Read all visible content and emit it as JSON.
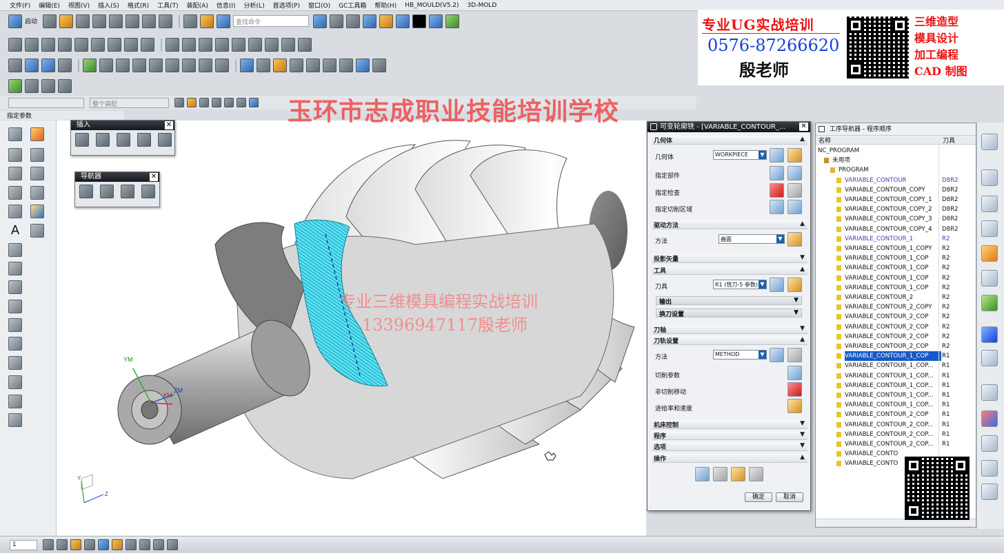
{
  "menu": [
    "文件(F)",
    "编辑(E)",
    "视图(V)",
    "插入(S)",
    "格式(R)",
    "工具(T)",
    "装配(A)",
    "信息(I)",
    "分析(L)",
    "首选项(P)",
    "窗口(O)",
    "GC工具箱",
    "帮助(H)",
    "HB_MOULD(V5.2)",
    "3D-MOLD"
  ],
  "toolbar": {
    "start_label": "启动",
    "search_placeholder": "查找命令"
  },
  "selection_bar": {
    "filter_value": "",
    "scope_value": "整个装配"
  },
  "panel_label": "指定参数",
  "insert_window": {
    "title": "插入"
  },
  "navigator_window": {
    "title": "导航器"
  },
  "ad": {
    "line1": "专业UG实战培训",
    "phone": "0576-87266620",
    "teacher": "殷老师",
    "tags": [
      "三维造型",
      "模具设计",
      "加工编程",
      "CAD 制图"
    ]
  },
  "school_name": "玉环市志成职业技能培训学校",
  "watermark": {
    "line1": "专业三维模具编程实战培训",
    "line2": "13396947117殷老师"
  },
  "axes": {
    "ym": "YM",
    "zm": "ZM",
    "xm": "XM",
    "y": "Y",
    "z": "Z"
  },
  "dialog": {
    "title": "可变轮廓铣 - [VARIABLE_CONTOUR_...",
    "sections": {
      "geometry": "几何体",
      "drive": "驱动方法",
      "projection": "投影矢量",
      "tool": "工具",
      "output": "输出",
      "tool_change": "换刀设置",
      "axis": "刀轴",
      "path_settings": "刀轨设置",
      "machine": "机床控制",
      "program": "程序",
      "options": "选项",
      "actions": "操作"
    },
    "labels": {
      "geometry": "几何体",
      "part": "指定部件",
      "check": "指定检查",
      "cut_area": "指定切削区域",
      "method_drive": "方法",
      "tool": "刀具",
      "method": "方法",
      "cut_params": "切削参数",
      "non_cut": "非切削移动",
      "feeds": "进给率和速度"
    },
    "values": {
      "geometry": "WORKPIECE",
      "drive_method": "曲面",
      "tool": "R1 (铣刀-5 参数)",
      "method": "METHOD"
    },
    "ok": "确定",
    "cancel": "取消"
  },
  "op_navigator": {
    "title": "工序导航器 - 程序顺序",
    "col_name": "名称",
    "col_tool": "刀具",
    "rows": [
      {
        "name": "NC_PROGRAM",
        "tool": "",
        "level": 0
      },
      {
        "name": "未用项",
        "tool": "",
        "level": 1
      },
      {
        "name": "PROGRAM",
        "tool": "",
        "level": 2
      },
      {
        "name": "VARIABLE_CONTOUR",
        "tool": "D8R2",
        "level": 3,
        "state": "purple"
      },
      {
        "name": "VARIABLE_CONTOUR_COPY",
        "tool": "D8R2",
        "level": 3
      },
      {
        "name": "VARIABLE_CONTOUR_COPY_1",
        "tool": "D8R2",
        "level": 3
      },
      {
        "name": "VARIABLE_CONTOUR_COPY_2",
        "tool": "D8R2",
        "level": 3
      },
      {
        "name": "VARIABLE_CONTOUR_COPY_3",
        "tool": "D8R2",
        "level": 3
      },
      {
        "name": "VARIABLE_CONTOUR_COPY_4",
        "tool": "D8R2",
        "level": 3
      },
      {
        "name": "VARIABLE_CONTOUR_1",
        "tool": "R2",
        "level": 3,
        "state": "purple"
      },
      {
        "name": "VARIABLE_CONTOUR_1_COPY",
        "tool": "R2",
        "level": 3
      },
      {
        "name": "VARIABLE_CONTOUR_1_COP",
        "tool": "R2",
        "level": 3
      },
      {
        "name": "VARIABLE_CONTOUR_1_COP",
        "tool": "R2",
        "level": 3
      },
      {
        "name": "VARIABLE_CONTOUR_1_COP",
        "tool": "R2",
        "level": 3
      },
      {
        "name": "VARIABLE_CONTOUR_1_COP",
        "tool": "R2",
        "level": 3
      },
      {
        "name": "VARIABLE_CONTOUR_2",
        "tool": "R2",
        "level": 3
      },
      {
        "name": "VARIABLE_CONTOUR_2_COPY",
        "tool": "R2",
        "level": 3
      },
      {
        "name": "VARIABLE_CONTOUR_2_COP",
        "tool": "R2",
        "level": 3
      },
      {
        "name": "VARIABLE_CONTOUR_2_COP",
        "tool": "R2",
        "level": 3
      },
      {
        "name": "VARIABLE_CONTOUR_2_COP",
        "tool": "R2",
        "level": 3
      },
      {
        "name": "VARIABLE_CONTOUR_2_COP",
        "tool": "R2",
        "level": 3
      },
      {
        "name": "VARIABLE_CONTOUR_1_COP",
        "tool": "R1",
        "level": 3,
        "state": "selected"
      },
      {
        "name": "VARIABLE_CONTOUR_1_COP...",
        "tool": "R1",
        "level": 3
      },
      {
        "name": "VARIABLE_CONTOUR_1_COP...",
        "tool": "R1",
        "level": 3
      },
      {
        "name": "VARIABLE_CONTOUR_1_COP...",
        "tool": "R1",
        "level": 3
      },
      {
        "name": "VARIABLE_CONTOUR_1_COP...",
        "tool": "R1",
        "level": 3
      },
      {
        "name": "VARIABLE_CONTOUR_1_COP...",
        "tool": "R1",
        "level": 3
      },
      {
        "name": "VARIABLE_CONTOUR_2_COP",
        "tool": "R1",
        "level": 3
      },
      {
        "name": "VARIABLE_CONTOUR_2_COP...",
        "tool": "R1",
        "level": 3
      },
      {
        "name": "VARIABLE_CONTOUR_2_COP...",
        "tool": "R1",
        "level": 3
      },
      {
        "name": "VARIABLE_CONTOUR_2_COP...",
        "tool": "R1",
        "level": 3
      },
      {
        "name": "VARIABLE_CONTO",
        "tool": "",
        "level": 3
      },
      {
        "name": "VARIABLE_CONTO",
        "tool": "",
        "level": 3
      }
    ]
  },
  "statusbar": {
    "layer_value": "1"
  },
  "colors": {
    "selection": "#1659c7",
    "toolpath": "#3fd0e8",
    "title_bar": "#15181c",
    "watermark": "#f04a4a"
  }
}
